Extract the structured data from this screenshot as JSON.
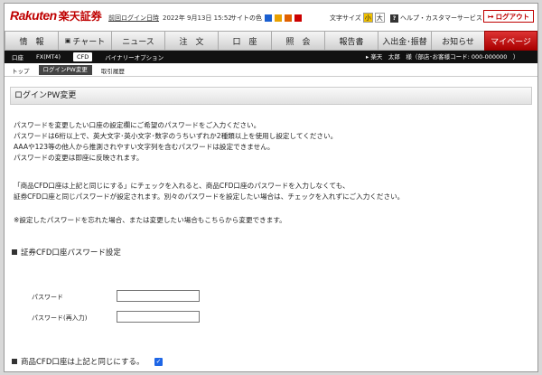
{
  "header": {
    "logo_en": "Rakuten",
    "logo_ja": "楽天証券",
    "last_login_label": "前回ログイン日時",
    "last_login_value": "2022年 9月13日  15:52",
    "site_color_label": "サイトの色",
    "site_colors": [
      "#1a5fd0",
      "#e8a000",
      "#e06000",
      "#cc0000"
    ],
    "font_size_label": "文字サイズ",
    "font_small": "小",
    "font_large": "大",
    "help_icon_text": "?",
    "help_label": "ヘルプ・カスタマーサービス",
    "logout_label": "ログアウト"
  },
  "main_nav": [
    {
      "label": "情　報"
    },
    {
      "label": "チャート"
    },
    {
      "label": "ニュース"
    },
    {
      "label": "注　文"
    },
    {
      "label": "口　座"
    },
    {
      "label": "照　会"
    },
    {
      "label": "報告書"
    },
    {
      "label": "入出金･振替"
    },
    {
      "label": "お知らせ"
    },
    {
      "label": "マイページ"
    }
  ],
  "sub_nav": {
    "items": [
      {
        "label": "口座"
      },
      {
        "label": "FX(MT4)"
      },
      {
        "label": "CFD"
      },
      {
        "label": "バイナリーオプション"
      }
    ],
    "user_text": "楽天　太郎　様（部店･お客様コード:  000-000000　）"
  },
  "third_nav": [
    {
      "label": "トップ"
    },
    {
      "label": "ログインPW変更"
    },
    {
      "label": "取引履歴"
    }
  ],
  "page": {
    "title": "ログインPW変更",
    "para1": [
      "パスワードを変更したい口座の設定欄にご希望のパスワードをご入力ください。",
      "パスワードは6桁以上で、英大文字･英小文字･数字のうちいずれか2種類以上を使用し設定してください。",
      "AAAや123等の他人から推測されやすい文字列を含むパスワードは設定できません。",
      "パスワードの変更は即座に反映されます。"
    ],
    "para2": [
      "「商品CFD口座は上記と同じにする」にチェックを入れると、商品CFD口座のパスワードを入力しなくても、",
      "証券CFD口座と同じパスワードが設定されます。別々のパスワードを設定したい場合は、チェックを入れずにご入力ください。"
    ],
    "note": "※設定したパスワードを忘れた場合、または変更したい場合もこちらから変更できます。",
    "section1_title": "証券CFD口座パスワード設定",
    "password_label": "パスワード",
    "password_value": "",
    "password_confirm_label": "パスワード(再入力)",
    "password_confirm_value": "",
    "section2_title": "商品CFD口座は上記と同じにする。",
    "same_checkbox_checked": true
  }
}
